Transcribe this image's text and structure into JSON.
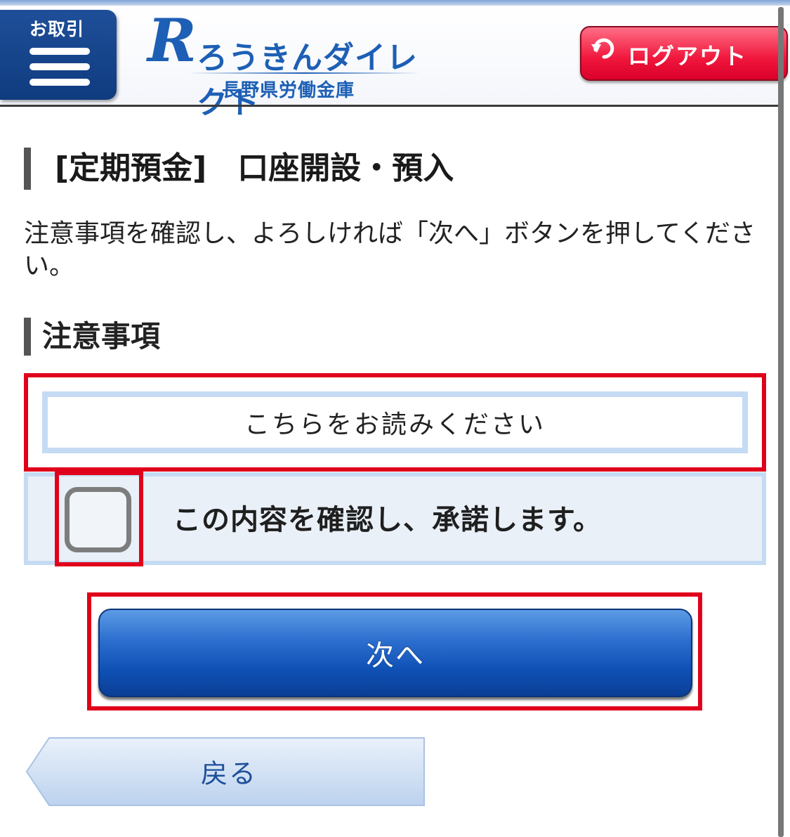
{
  "header": {
    "menu_label": "お取引",
    "logo_mark": "R",
    "logo_name": "ろうきんダイレクト",
    "logo_sub": "長野県労働金庫",
    "logout_label": "ログアウト"
  },
  "page": {
    "title": "[定期預金]　口座開設・預入",
    "instruction": "注意事項を確認し、よろしければ「次へ」ボタンを押してください。",
    "section_title": "注意事項"
  },
  "notice": {
    "read_label": "こちらをお読みください",
    "agree_label": "この内容を確認し、承諾します。",
    "agree_checked": false
  },
  "actions": {
    "next_label": "次へ",
    "back_label": "戻る"
  },
  "colors": {
    "brand_blue": "#1d5fb5",
    "logout_red": "#f0163c",
    "highlight_red": "#e0001b",
    "next_blue": "#0f50b5"
  }
}
